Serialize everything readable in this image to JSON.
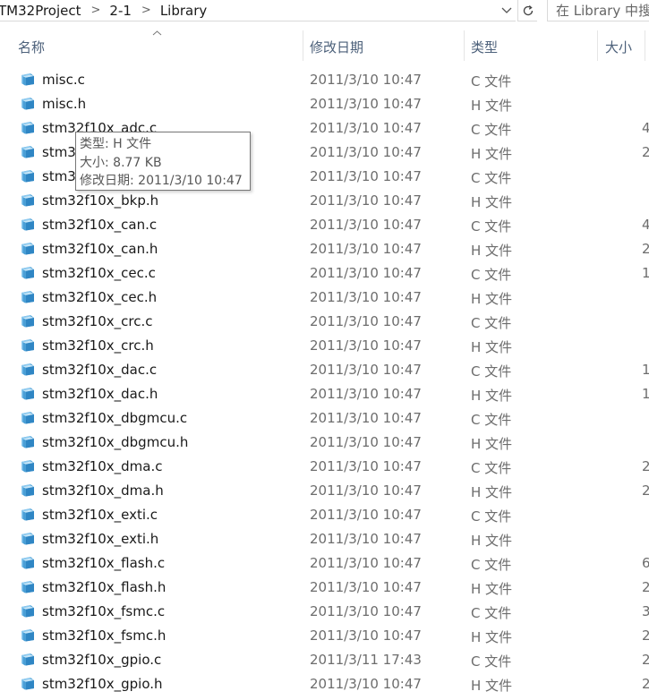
{
  "address_bar": {
    "breadcrumbs": [
      "TM32Project",
      "2-1",
      "Library"
    ],
    "separator": ">",
    "dropdown_icon": "chevron-down-icon",
    "refresh_icon": "refresh-icon",
    "search_placeholder": "在 Library 中搜"
  },
  "columns": {
    "name": "名称",
    "date": "修改日期",
    "type": "类型",
    "size": "大小"
  },
  "files": [
    {
      "name": "misc.c",
      "date": "2011/3/10 10:47",
      "type": "C 文件",
      "size": ""
    },
    {
      "name": "misc.h",
      "date": "2011/3/10 10:47",
      "type": "H 文件",
      "size": ""
    },
    {
      "name": "stm32f10x_adc.c",
      "date": "2011/3/10 10:47",
      "type": "C 文件",
      "size": "4"
    },
    {
      "name": "stm32f10x_adc.h",
      "date": "2011/3/10 10:47",
      "type": "H 文件",
      "size": "2"
    },
    {
      "name": "stm32f10x_bkp.c",
      "date": "2011/3/10 10:47",
      "type": "C 文件",
      "size": ""
    },
    {
      "name": "stm32f10x_bkp.h",
      "date": "2011/3/10 10:47",
      "type": "H 文件",
      "size": ""
    },
    {
      "name": "stm32f10x_can.c",
      "date": "2011/3/10 10:47",
      "type": "C 文件",
      "size": "4"
    },
    {
      "name": "stm32f10x_can.h",
      "date": "2011/3/10 10:47",
      "type": "H 文件",
      "size": "2"
    },
    {
      "name": "stm32f10x_cec.c",
      "date": "2011/3/10 10:47",
      "type": "C 文件",
      "size": "1"
    },
    {
      "name": "stm32f10x_cec.h",
      "date": "2011/3/10 10:47",
      "type": "H 文件",
      "size": ""
    },
    {
      "name": "stm32f10x_crc.c",
      "date": "2011/3/10 10:47",
      "type": "C 文件",
      "size": ""
    },
    {
      "name": "stm32f10x_crc.h",
      "date": "2011/3/10 10:47",
      "type": "H 文件",
      "size": ""
    },
    {
      "name": "stm32f10x_dac.c",
      "date": "2011/3/10 10:47",
      "type": "C 文件",
      "size": "1"
    },
    {
      "name": "stm32f10x_dac.h",
      "date": "2011/3/10 10:47",
      "type": "H 文件",
      "size": "1"
    },
    {
      "name": "stm32f10x_dbgmcu.c",
      "date": "2011/3/10 10:47",
      "type": "C 文件",
      "size": ""
    },
    {
      "name": "stm32f10x_dbgmcu.h",
      "date": "2011/3/10 10:47",
      "type": "H 文件",
      "size": ""
    },
    {
      "name": "stm32f10x_dma.c",
      "date": "2011/3/10 10:47",
      "type": "C 文件",
      "size": "2"
    },
    {
      "name": "stm32f10x_dma.h",
      "date": "2011/3/10 10:47",
      "type": "H 文件",
      "size": "2"
    },
    {
      "name": "stm32f10x_exti.c",
      "date": "2011/3/10 10:47",
      "type": "C 文件",
      "size": ""
    },
    {
      "name": "stm32f10x_exti.h",
      "date": "2011/3/10 10:47",
      "type": "H 文件",
      "size": ""
    },
    {
      "name": "stm32f10x_flash.c",
      "date": "2011/3/10 10:47",
      "type": "C 文件",
      "size": "6"
    },
    {
      "name": "stm32f10x_flash.h",
      "date": "2011/3/10 10:47",
      "type": "H 文件",
      "size": "2"
    },
    {
      "name": "stm32f10x_fsmc.c",
      "date": "2011/3/10 10:47",
      "type": "C 文件",
      "size": "3"
    },
    {
      "name": "stm32f10x_fsmc.h",
      "date": "2011/3/10 10:47",
      "type": "H 文件",
      "size": "2"
    },
    {
      "name": "stm32f10x_gpio.c",
      "date": "2011/3/11 17:43",
      "type": "C 文件",
      "size": "2"
    },
    {
      "name": "stm32f10x_gpio.h",
      "date": "2011/3/10 10:47",
      "type": "H 文件",
      "size": "2"
    }
  ],
  "tooltip": {
    "type_line": "类型: H 文件",
    "size_line": "大小: 8.77 KB",
    "date_line": "修改日期: 2011/3/10 10:47"
  },
  "colors": {
    "header_text": "#4c607a",
    "secondary_text": "#6d6d6d",
    "file_icon": "#4a9fd6"
  }
}
